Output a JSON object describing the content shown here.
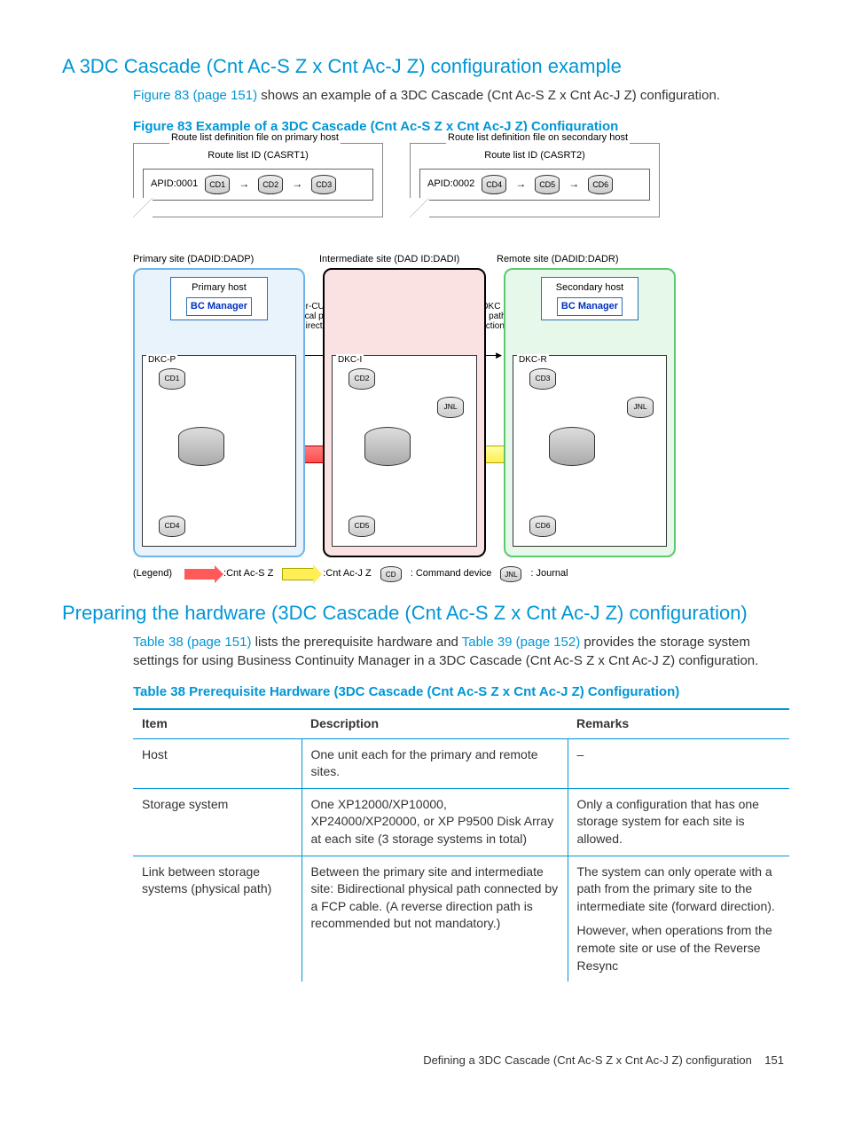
{
  "heading1": "A 3DC Cascade (Cnt Ac-S Z x Cnt Ac-J Z) configuration example",
  "intro_link": "Figure 83 (page 151)",
  "intro_rest": " shows an example of a 3DC Cascade (Cnt Ac-S Z x Cnt Ac-J Z) configuration.",
  "fig_caption": "Figure 83 Example of a 3DC Cascade (Cnt Ac-S Z x Cnt Ac-J Z) Configuration",
  "diagram": {
    "route_primary_title": "Route list definition file on primary host",
    "route_primary_id": "Route list ID (CASRT1)",
    "route_primary_apid": "APID:0001",
    "cd1": "CD1",
    "cd2": "CD2",
    "cd3": "CD3",
    "route_secondary_title": "Route list definition file on secondary host",
    "route_secondary_id": "Route list ID (CASRT2)",
    "route_secondary_apid": "APID:0002",
    "cd4": "CD4",
    "cd5": "CD5",
    "cd6": "CD6",
    "primary_site": "Primary site  (DADID:DADP)",
    "intermediate_site": "Intermediate site (DAD ID:DADI)",
    "remote_site": "Remote site  (DADID:DADR)",
    "primary_host": "Primary host",
    "secondary_host": "Secondary host",
    "bc_manager": "BC Manager",
    "dkc_p": "DKC-P",
    "dkc_i": "DKC-I",
    "dkc_r": "DKC-R",
    "inter_cu": "Inter-CU\nlogical path\n(bidirectional)",
    "inter_dkc": "Inter-DKC\nlogical path\n(bidirectional)",
    "jnl": "JNL",
    "legend_label": "(Legend)",
    "legend_cnt_s": ":Cnt Ac-S Z",
    "legend_cnt_j": ":Cnt Ac-J Z",
    "legend_cd": "CD",
    "legend_cmd": ": Command device",
    "legend_jnl": ": Journal"
  },
  "heading2": "Preparing the hardware (3DC Cascade (Cnt Ac-S Z x Cnt Ac-J Z) configuration)",
  "p2_link1": "Table 38 (page 151)",
  "p2_mid": " lists the prerequisite hardware and ",
  "p2_link2": "Table 39 (page 152)",
  "p2_rest": " provides the storage system settings for using Business Continuity Manager in a 3DC Cascade (Cnt Ac-S Z x Cnt Ac-J Z) configuration.",
  "tbl_caption": "Table 38 Prerequisite Hardware (3DC Cascade (Cnt Ac-S Z x Cnt Ac-J Z) Configuration)",
  "table": {
    "h1": "Item",
    "h2": "Description",
    "h3": "Remarks",
    "r1c1": "Host",
    "r1c2": "One unit each for the primary and remote sites.",
    "r1c3": "–",
    "r2c1": "Storage system",
    "r2c2": "One XP12000/XP10000, XP24000/XP20000, or XP P9500 Disk Array at each site (3 storage systems in total)",
    "r2c3": "Only a configuration that has one storage system for each site is allowed.",
    "r3c1": "Link between storage systems (physical path)",
    "r3c2": "Between the primary site and intermediate site: Bidirectional physical path connected by a FCP cable. (A reverse direction path is recommended but not mandatory.)",
    "r3c3a": "The system can only operate with a path from the primary site to the intermediate site (forward direction).",
    "r3c3b": "However, when operations from the remote site or use of the Reverse Resync"
  },
  "footer_text": "Defining a 3DC Cascade (Cnt Ac-S Z x Cnt Ac-J Z) configuration",
  "footer_page": "151"
}
